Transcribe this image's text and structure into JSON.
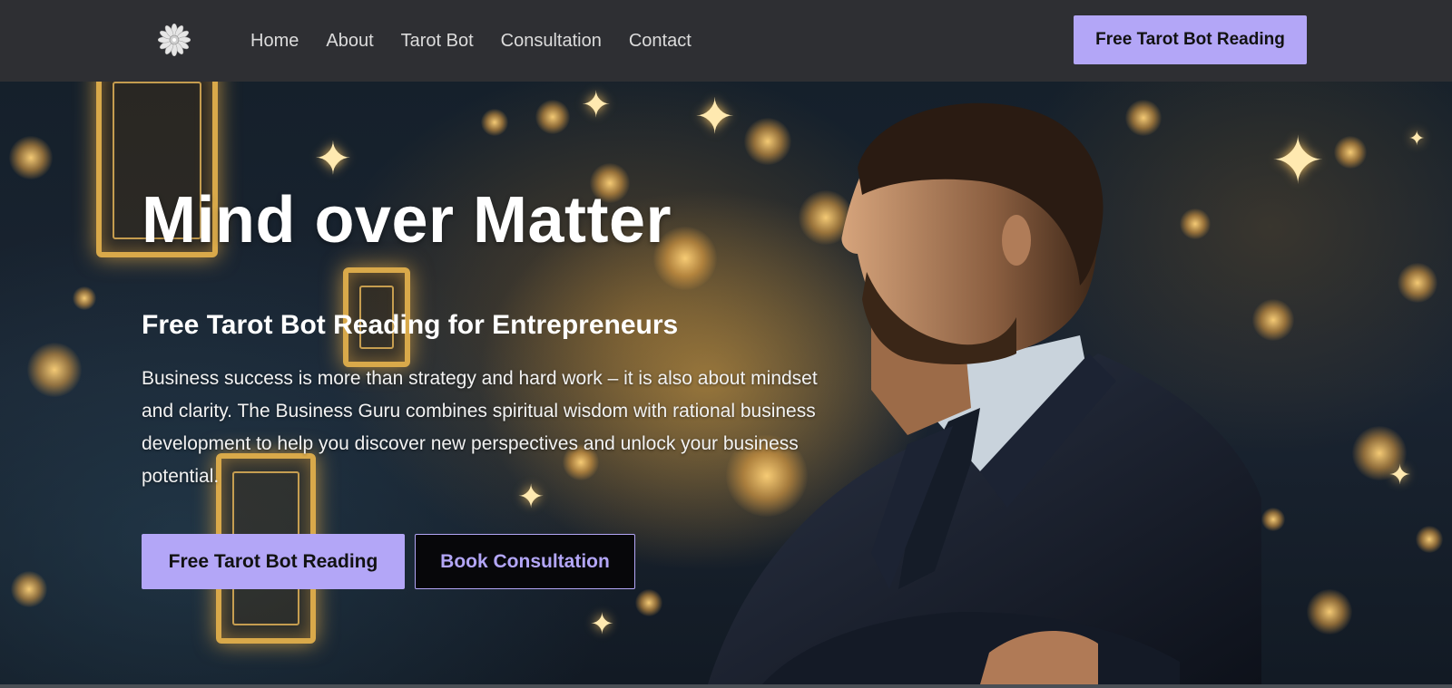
{
  "nav": {
    "logo_icon": "mandala-flower-icon",
    "links": [
      "Home",
      "About",
      "Tarot Bot",
      "Consultation",
      "Contact"
    ],
    "cta_label": "Free Tarot Bot Reading"
  },
  "hero": {
    "title": "Mind over Matter",
    "subtitle": "Free Tarot Bot Reading for Entrepreneurs",
    "description": "Business success is more than strategy and hard work – it is also about mindset and clarity. The Business Guru combines spiritual wisdom with rational business development to help you discover new perspectives and unlock your business potential.",
    "primary_button": "Free Tarot Bot Reading",
    "secondary_button": "Book Consultation"
  },
  "colors": {
    "nav_background": "#2e2f33",
    "accent": "#b3a6f7",
    "secondary_button_bg": "#07070a",
    "gold_glow": "#d9a94a"
  }
}
